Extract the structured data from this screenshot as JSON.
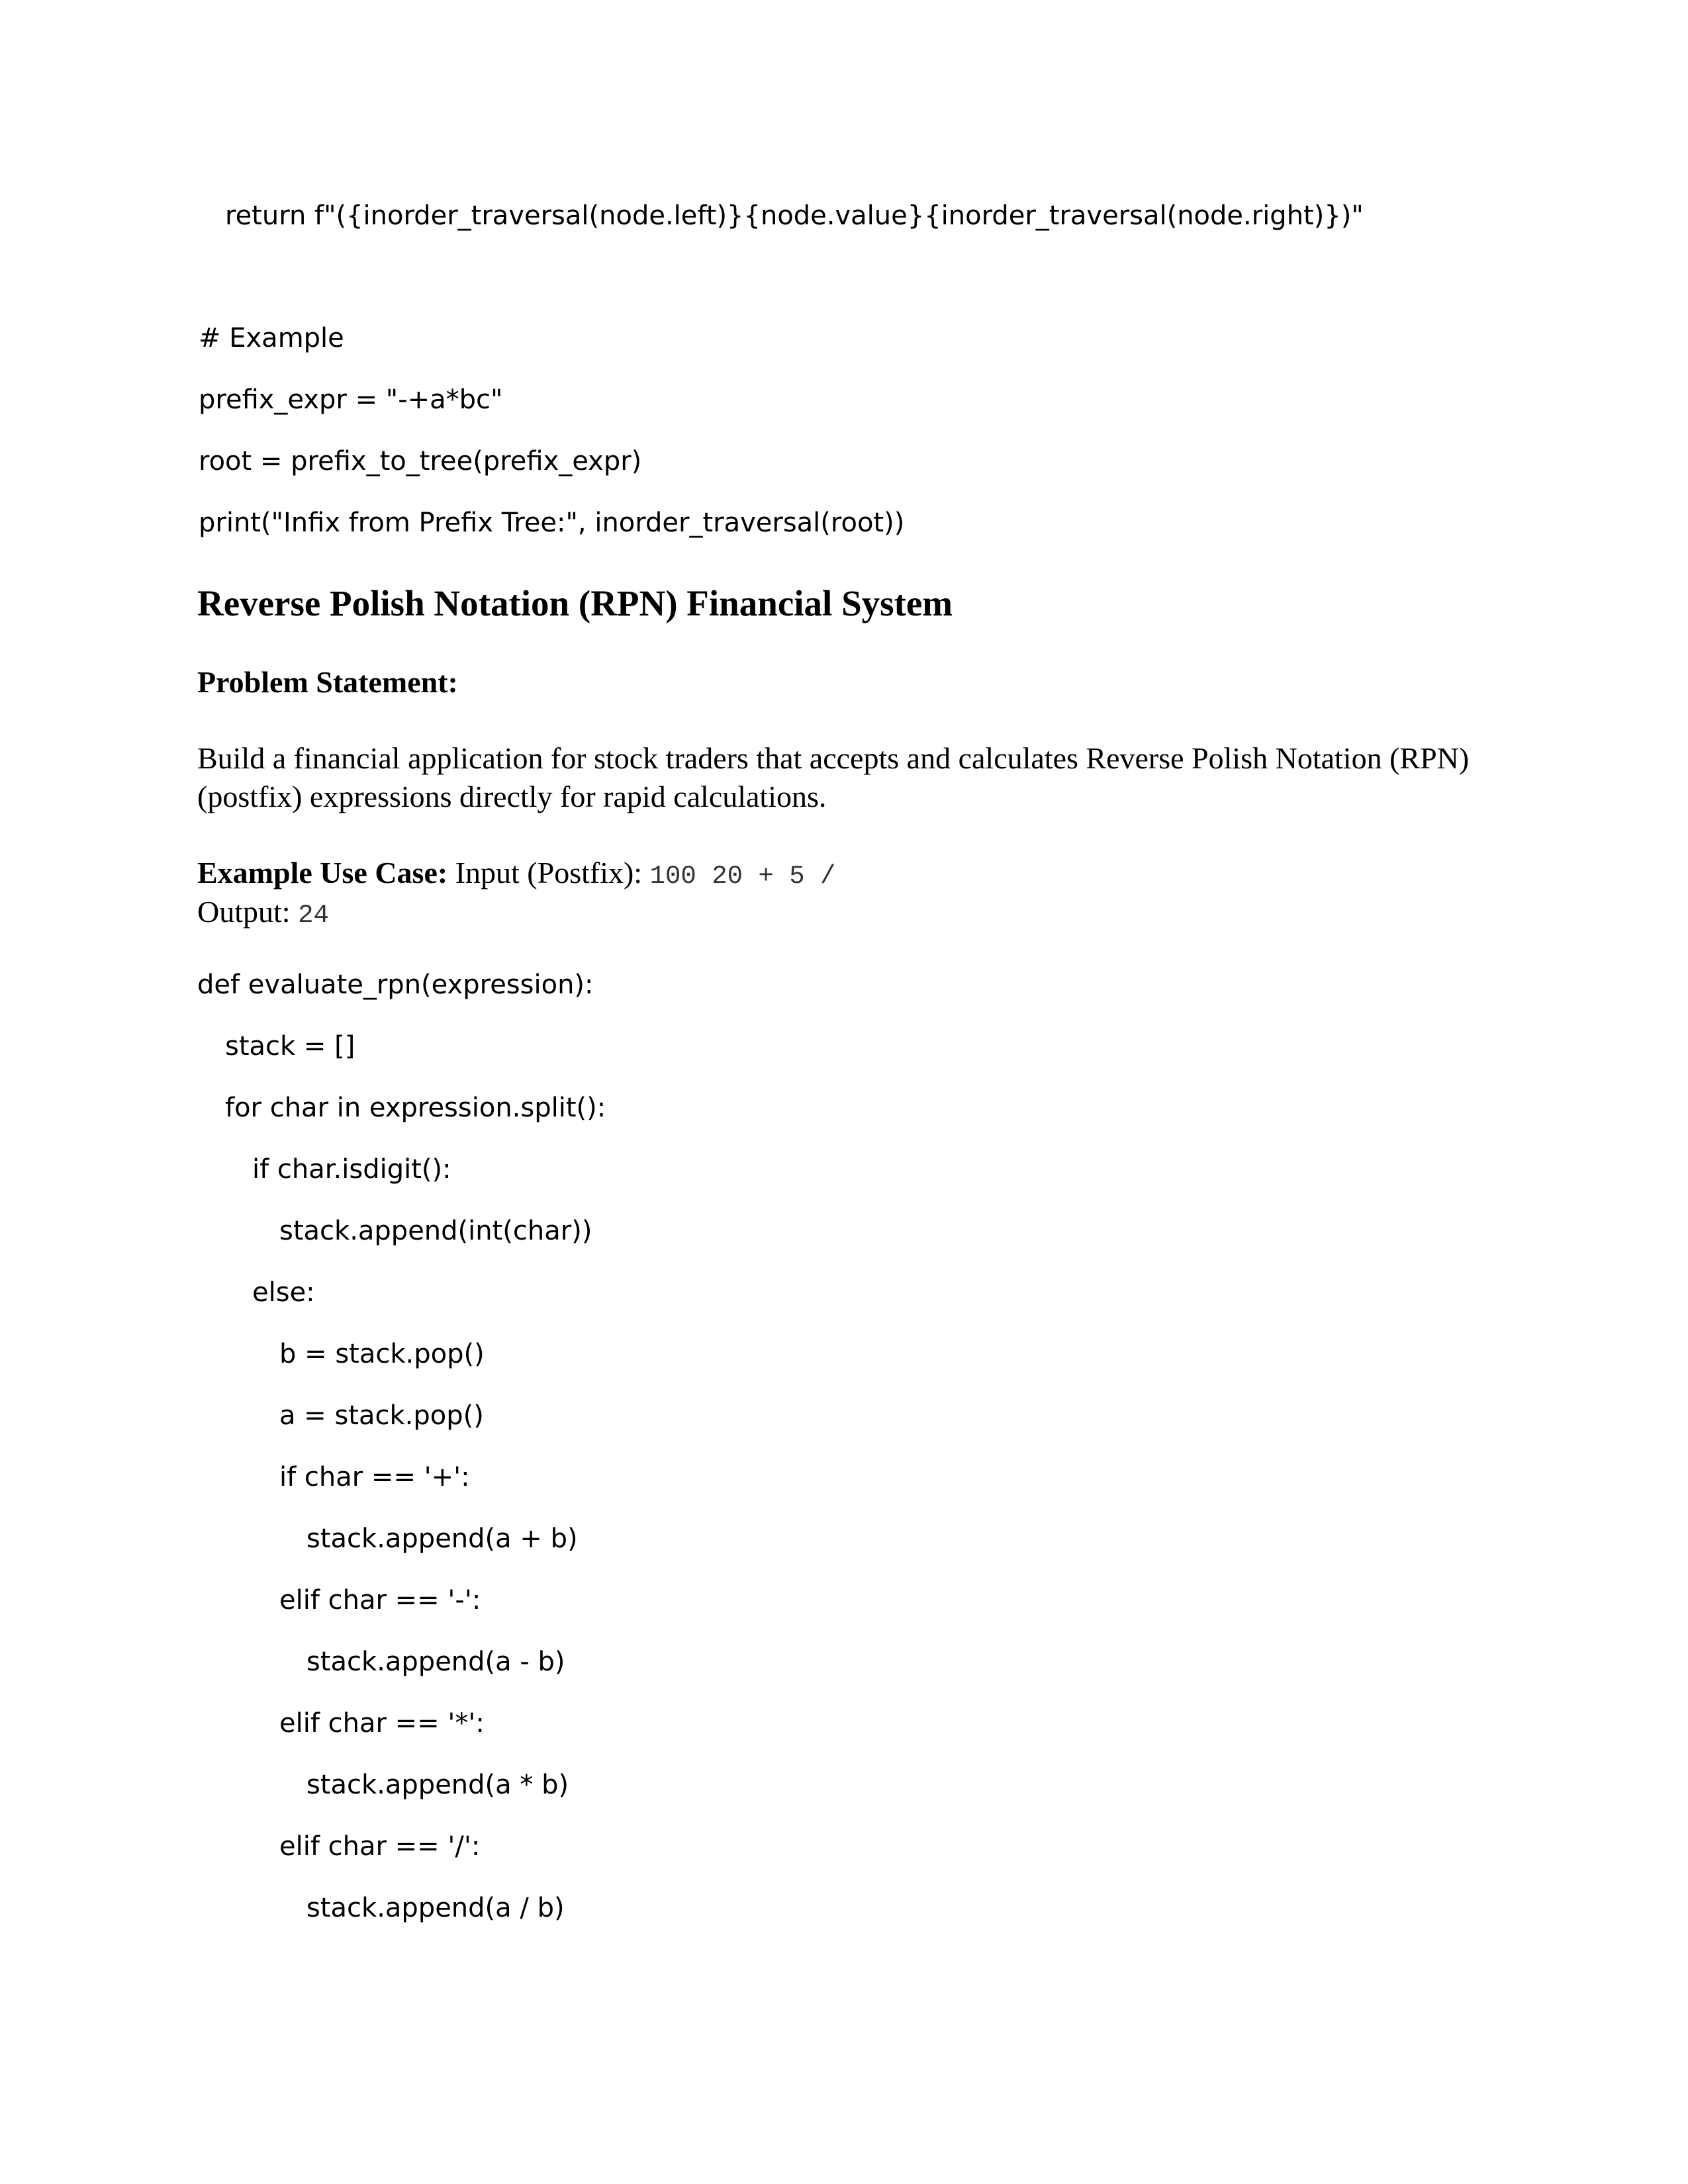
{
  "top_code": {
    "return_line": "return f\"({inorder_traversal(node.left)}{node.value}{inorder_traversal(node.right)})\""
  },
  "example_code": {
    "comment": "# Example",
    "line1": "prefix_expr = \"-+a*bc\"",
    "line2": "root = prefix_to_tree(prefix_expr)",
    "line3": "print(\"Infix from Prefix Tree:\", inorder_traversal(root))"
  },
  "section": {
    "title": "Reverse Polish Notation (RPN) Financial System",
    "problem_heading": "Problem Statement:",
    "problem_text": "Build a financial application for stock traders that accepts and calculates Reverse Polish Notation (RPN) (postfix) expressions directly for rapid calculations.",
    "use_case_label": "Example Use Case:",
    "input_label": " Input (Postfix): ",
    "input_value": "100 20 + 5 /",
    "output_label": "Output: ",
    "output_value": "24"
  },
  "rpn_code": {
    "lines": [
      "def evaluate_rpn(expression):",
      "stack = []",
      "for char in expression.split():",
      "if char.isdigit():",
      "stack.append(int(char))",
      "else:",
      "b = stack.pop()",
      "a = stack.pop()",
      "if char == '+':",
      "stack.append(a + b)",
      "elif char == '-':",
      "stack.append(a - b)",
      "elif char == '*':",
      "stack.append(a * b)",
      "elif char == '/':",
      "stack.append(a / b)"
    ]
  }
}
